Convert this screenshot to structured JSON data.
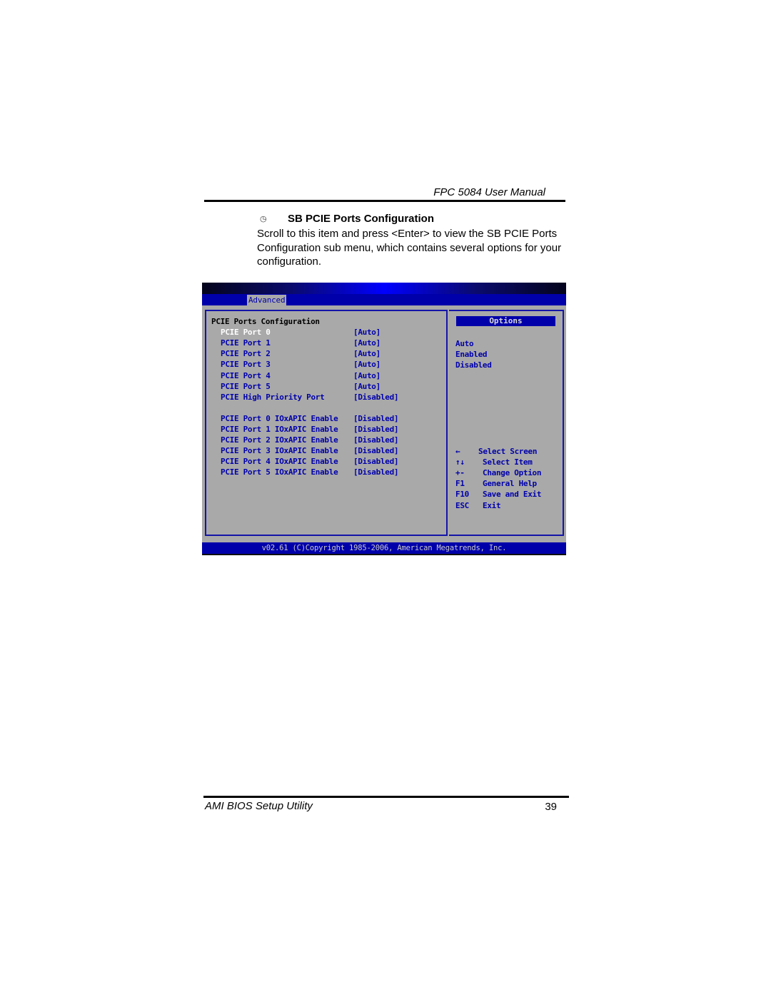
{
  "header": {
    "title": "FPC 5084 User Manual"
  },
  "section": {
    "bullet_icon": "clock-bullet-icon",
    "title": "SB PCIE Ports Configuration",
    "body": "Scroll to this item and press <Enter> to view the SB PCIE Ports Configuration sub menu, which contains several options for your configuration."
  },
  "bios": {
    "menu_tab": "Advanced",
    "heading": "PCIE Ports Configuration",
    "items": [
      {
        "label": "PCIE Port 0",
        "value": "[Auto]",
        "selected": true
      },
      {
        "label": "PCIE Port 1",
        "value": "[Auto]"
      },
      {
        "label": "PCIE Port 2",
        "value": "[Auto]"
      },
      {
        "label": "PCIE Port 3",
        "value": "[Auto]"
      },
      {
        "label": "PCIE Port 4",
        "value": "[Auto]"
      },
      {
        "label": "PCIE Port 5",
        "value": "[Auto]"
      },
      {
        "label": "PCIE High Priority Port",
        "value": "[Disabled]"
      },
      {
        "label": "PCIE Port 0 IOxAPIC Enable",
        "value": "[Disabled]"
      },
      {
        "label": "PCIE Port 1 IOxAPIC Enable",
        "value": "[Disabled]"
      },
      {
        "label": "PCIE Port 2 IOxAPIC Enable",
        "value": "[Disabled]"
      },
      {
        "label": "PCIE Port 3 IOxAPIC Enable",
        "value": "[Disabled]"
      },
      {
        "label": "PCIE Port 4 IOxAPIC Enable",
        "value": "[Disabled]"
      },
      {
        "label": "PCIE Port 5 IOxAPIC Enable",
        "value": "[Disabled]"
      }
    ],
    "options_title": "Options",
    "options": [
      "Auto",
      "Enabled",
      "Disabled"
    ],
    "keys": [
      {
        "key": "←",
        "action": "Select Screen"
      },
      {
        "key": "↑↓",
        "action": "Select Item"
      },
      {
        "key": "+-",
        "action": "Change Option"
      },
      {
        "key": "F1",
        "action": "General Help"
      },
      {
        "key": "F10",
        "action": "Save and Exit"
      },
      {
        "key": "ESC",
        "action": "Exit"
      }
    ],
    "footer": "v02.61 (C)Copyright 1985-2006, American Megatrends, Inc.",
    "colors": {
      "bios_blue": "#0000aa",
      "bios_gray": "#a9a9a9",
      "selected_text": "#ffffff"
    }
  },
  "footer": {
    "left": "AMI BIOS Setup Utility",
    "page_number": "39"
  }
}
